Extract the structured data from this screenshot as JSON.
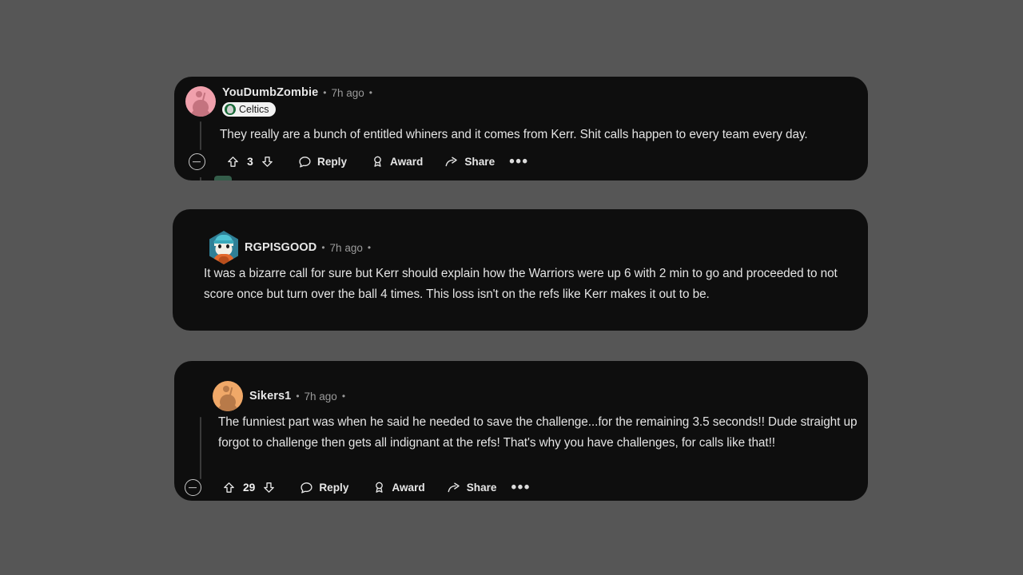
{
  "theme": {
    "page_background": "#565656",
    "card_background": "#0e0e0e",
    "text_primary": "#e4e4e4",
    "text_muted": "#9a9a9a",
    "flair_background": "#f2f2f2",
    "flair_text": "#1c1c1c"
  },
  "comments": [
    {
      "id": "comment-1",
      "author": "YouDumbZombie",
      "separator": "•",
      "timestamp": "7h ago",
      "trailing_separator": "•",
      "avatar": "reddit-snoo-avatar-pink",
      "flair": {
        "label": "Celtics",
        "icon": "celtics-logo-icon"
      },
      "body": "They really are a bunch of entitled whiners and it comes from Kerr. Shit calls happen to every team every day.",
      "actions": {
        "collapse": "collapse-thread",
        "upvote": "upvote-arrow",
        "score": "3",
        "downvote": "downvote-arrow",
        "reply": "Reply",
        "award": "Award",
        "share": "Share",
        "overflow": "•••"
      }
    },
    {
      "id": "comment-2",
      "author": "RGPISGOOD",
      "separator": "•",
      "timestamp": "7h ago",
      "trailing_separator": "•",
      "avatar": "reddit-custom-hex-avatar-cat-beanie",
      "flair": null,
      "body": "It was a bizarre call for sure but Kerr should explain how the Warriors were up 6 with 2 min to go and proceeded to not score once but turn over the ball 4 times. This loss isn't on the refs like Kerr makes it out to be.",
      "actions": null
    },
    {
      "id": "comment-3",
      "author": "Sikers1",
      "separator": "•",
      "timestamp": "7h ago",
      "trailing_separator": "•",
      "avatar": "reddit-snoo-avatar-orange",
      "flair": null,
      "body": "The funniest part was when he said he needed to save the challenge...for the remaining 3.5 seconds!! Dude straight up forgot to challenge then gets all indignant at the refs! That's why you have challenges, for calls like that!!",
      "actions": {
        "collapse": "collapse-thread",
        "upvote": "upvote-arrow",
        "score": "29",
        "downvote": "downvote-arrow",
        "reply": "Reply",
        "award": "Award",
        "share": "Share",
        "overflow": "•••"
      }
    }
  ]
}
